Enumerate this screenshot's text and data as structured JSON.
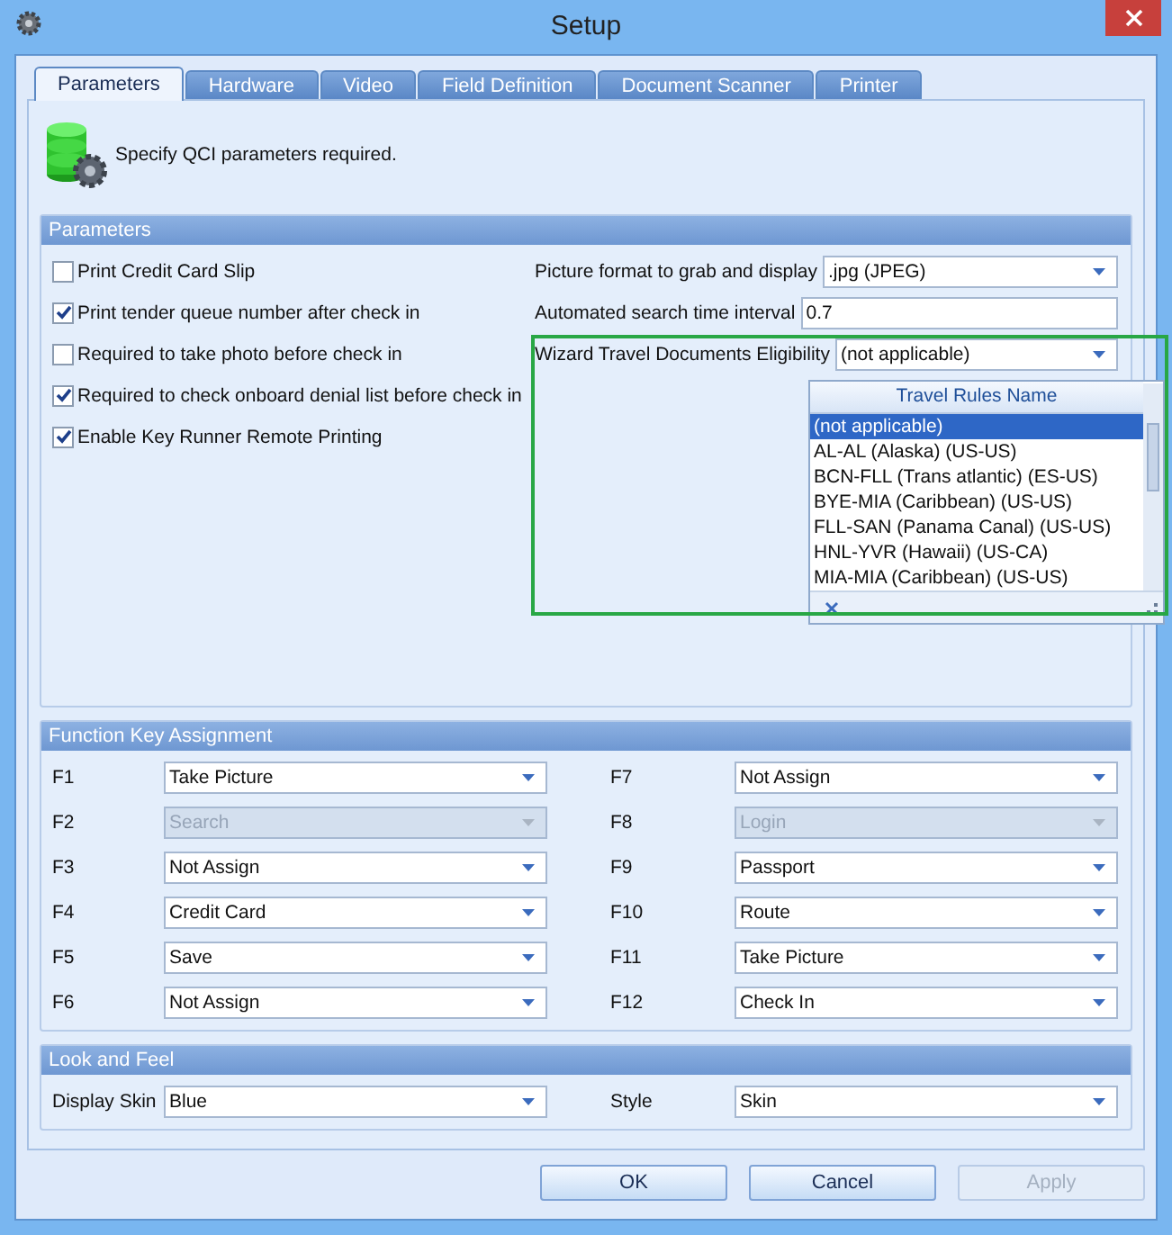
{
  "window": {
    "title": "Setup"
  },
  "tabs": [
    {
      "label": "Parameters",
      "selected": true
    },
    {
      "label": "Hardware",
      "selected": false
    },
    {
      "label": "Video",
      "selected": false
    },
    {
      "label": "Field Definition",
      "selected": false
    },
    {
      "label": "Document Scanner",
      "selected": false
    },
    {
      "label": "Printer",
      "selected": false
    }
  ],
  "header": {
    "text": "Specify QCI parameters required."
  },
  "parameters": {
    "title": "Parameters",
    "checkboxes": [
      {
        "label": "Print Credit Card Slip",
        "checked": false
      },
      {
        "label": "Print tender queue number after check in",
        "checked": true
      },
      {
        "label": "Required to take photo before check in",
        "checked": false
      },
      {
        "label": "Required to check onboard denial list before check in",
        "checked": true
      },
      {
        "label": "Enable Key Runner Remote Printing",
        "checked": true
      }
    ],
    "fields": [
      {
        "label": "Picture format to grab and display",
        "value": ".jpg (JPEG)",
        "kind": "dropdown"
      },
      {
        "label": "Automated search time interval",
        "value": "0.7",
        "kind": "text"
      },
      {
        "label": "Wizard Travel Documents Eligibility",
        "value": "(not applicable)",
        "kind": "dropdown"
      }
    ],
    "dropdown_list": {
      "column": "Travel Rules Name",
      "items": [
        {
          "label": "(not applicable)",
          "selected": true
        },
        {
          "label": "AL-AL (Alaska) (US-US)",
          "selected": false
        },
        {
          "label": "BCN-FLL (Trans atlantic) (ES-US)",
          "selected": false
        },
        {
          "label": "BYE-MIA  (Caribbean) (US-US)",
          "selected": false
        },
        {
          "label": "FLL-SAN (Panama Canal) (US-US)",
          "selected": false
        },
        {
          "label": "HNL-YVR (Hawaii) (US-CA)",
          "selected": false
        },
        {
          "label": "MIA-MIA (Caribbean) (US-US)",
          "selected": false
        }
      ]
    }
  },
  "function_keys": {
    "title": "Function Key Assignment",
    "columns": [
      [
        {
          "key": "F1",
          "value": "Take Picture",
          "disabled": false
        },
        {
          "key": "F2",
          "value": "Search",
          "disabled": true
        },
        {
          "key": "F3",
          "value": "Not Assign",
          "disabled": false
        },
        {
          "key": "F4",
          "value": "Credit Card",
          "disabled": false
        },
        {
          "key": "F5",
          "value": "Save",
          "disabled": false
        },
        {
          "key": "F6",
          "value": "Not Assign",
          "disabled": false
        }
      ],
      [
        {
          "key": "F7",
          "value": "Not Assign",
          "disabled": false
        },
        {
          "key": "F8",
          "value": "Login",
          "disabled": true
        },
        {
          "key": "F9",
          "value": "Passport",
          "disabled": false
        },
        {
          "key": "F10",
          "value": "Route",
          "disabled": false
        },
        {
          "key": "F11",
          "value": "Take Picture",
          "disabled": false
        },
        {
          "key": "F12",
          "value": "Check In",
          "disabled": false
        }
      ]
    ]
  },
  "look_and_feel": {
    "title": "Look and Feel",
    "fields": [
      {
        "label": "Display Skin",
        "value": "Blue"
      },
      {
        "label": "Style",
        "value": "Skin"
      }
    ]
  },
  "buttons": [
    {
      "label": "OK",
      "disabled": false
    },
    {
      "label": "Cancel",
      "disabled": false
    },
    {
      "label": "Apply",
      "disabled": true
    }
  ]
}
